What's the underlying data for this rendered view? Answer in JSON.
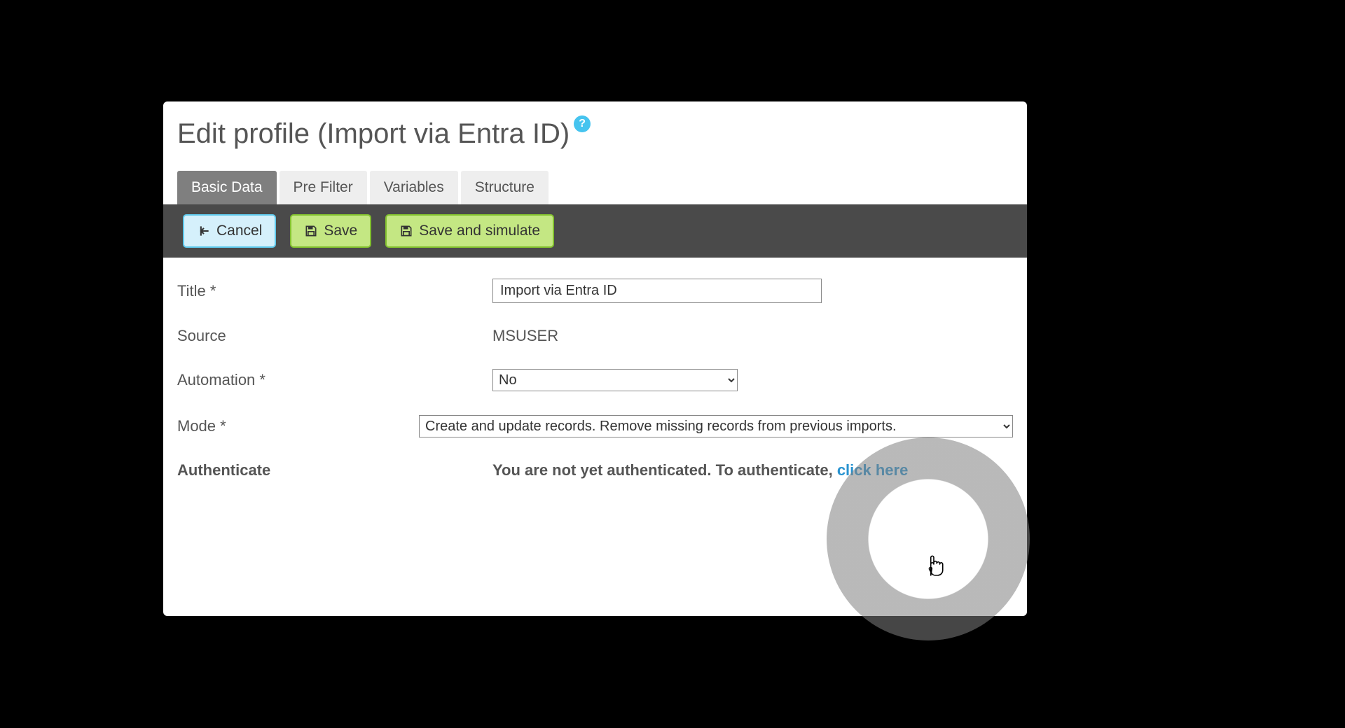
{
  "header": {
    "title": "Edit profile (Import via Entra ID)",
    "help_icon": "?"
  },
  "tabs": [
    {
      "label": "Basic Data",
      "active": true
    },
    {
      "label": "Pre Filter",
      "active": false
    },
    {
      "label": "Variables",
      "active": false
    },
    {
      "label": "Structure",
      "active": false
    }
  ],
  "toolbar": {
    "cancel_label": "Cancel",
    "save_label": "Save",
    "save_simulate_label": "Save and simulate"
  },
  "form": {
    "title_label": "Title *",
    "title_value": "Import via Entra ID",
    "source_label": "Source",
    "source_value": "MSUSER",
    "automation_label": "Automation *",
    "automation_value": "No",
    "mode_label": "Mode *",
    "mode_value": "Create and update records. Remove missing records from previous imports.",
    "auth_label": "Authenticate",
    "auth_text": "You are not yet authenticated. To authenticate, ",
    "auth_link": "click here"
  }
}
